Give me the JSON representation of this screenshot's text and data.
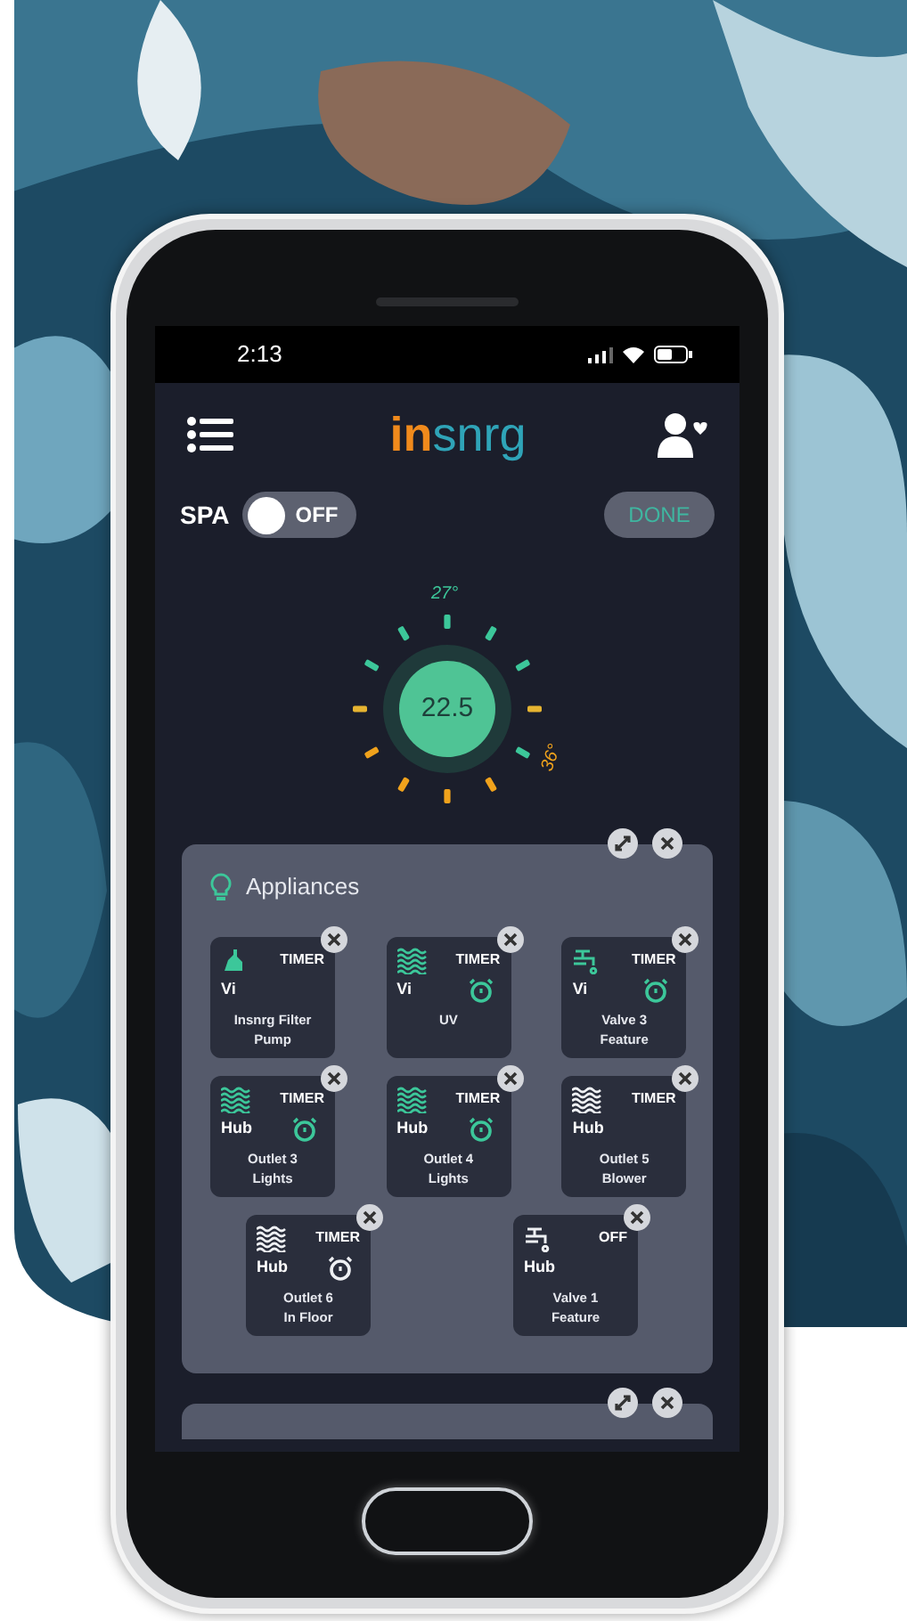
{
  "status_bar": {
    "time": "2:13"
  },
  "header": {
    "logo_accent": "in",
    "logo_rest": "snrg"
  },
  "spa": {
    "label": "SPA",
    "on": false,
    "state_text": "OFF",
    "done_button": "DONE"
  },
  "dial": {
    "value": "22.5",
    "top_label": "27°",
    "side_label": "36°"
  },
  "appliances": {
    "title": "Appliances",
    "tiles": [
      {
        "kind": "pump",
        "active": true,
        "mode": "TIMER",
        "source": "Vi",
        "timer": false,
        "lines": [
          "Insnrg Filter",
          "Pump"
        ]
      },
      {
        "kind": "waves",
        "active": true,
        "mode": "TIMER",
        "source": "Vi",
        "timer": true,
        "lines": [
          "UV"
        ]
      },
      {
        "kind": "valve",
        "active": true,
        "mode": "TIMER",
        "source": "Vi",
        "timer": true,
        "lines": [
          "Valve 3",
          "Feature"
        ]
      },
      {
        "kind": "waves",
        "active": true,
        "mode": "TIMER",
        "source": "Hub",
        "timer": true,
        "lines": [
          "Outlet 3",
          "Lights"
        ]
      },
      {
        "kind": "waves",
        "active": true,
        "mode": "TIMER",
        "source": "Hub",
        "timer": true,
        "lines": [
          "Outlet 4",
          "Lights"
        ]
      },
      {
        "kind": "waves",
        "active": false,
        "mode": "TIMER",
        "source": "Hub",
        "timer": false,
        "lines": [
          "Outlet 5",
          "Blower"
        ]
      },
      {
        "kind": "waves",
        "active": false,
        "mode": "TIMER",
        "source": "Hub",
        "timer": true,
        "lines": [
          "Outlet 6",
          "In Floor"
        ]
      },
      {
        "kind": "valve",
        "active": false,
        "mode": "OFF",
        "source": "Hub",
        "timer": false,
        "lines": [
          "Valve 1",
          "Feature"
        ]
      }
    ]
  }
}
